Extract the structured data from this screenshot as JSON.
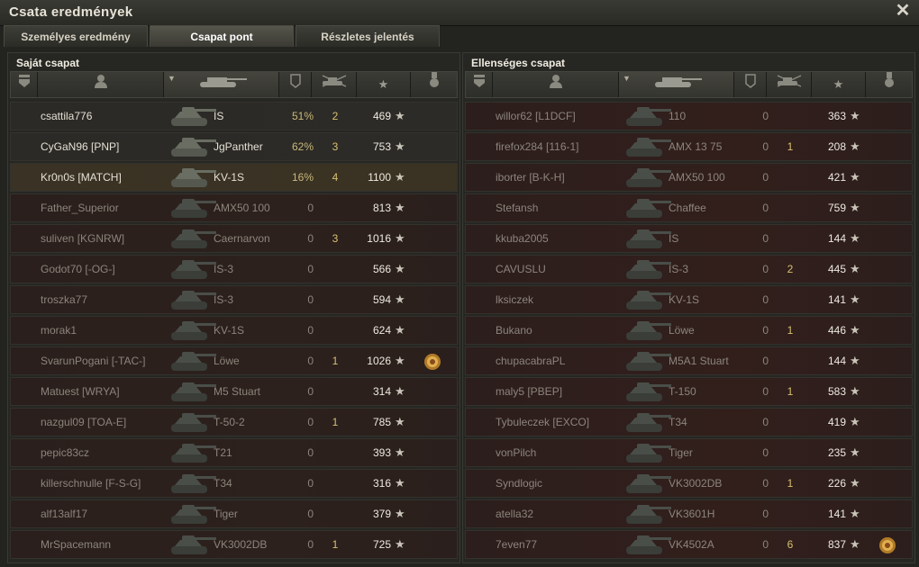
{
  "window": {
    "title": "Csata eredmények",
    "close": "✕"
  },
  "tabs": [
    {
      "label": "Személyes eredmény",
      "active": false
    },
    {
      "label": "Csapat pont",
      "active": true
    },
    {
      "label": "Részletes jelentés",
      "active": false
    }
  ],
  "colors": {
    "accent": "#c8b87a",
    "kills": "#d8c070",
    "dead_row": "#2d211d",
    "player_row": "#3a3322"
  },
  "left_team": {
    "title": "Saját csapat",
    "rows": [
      {
        "name": "csattila776",
        "tank": "IS",
        "pct": "51%",
        "kills": "2",
        "exp": "469",
        "state": "alive",
        "medal": false
      },
      {
        "name": "CyGaN96 [PNP]",
        "tank": "JgPanther",
        "pct": "62%",
        "kills": "3",
        "exp": "753",
        "state": "alive",
        "medal": false
      },
      {
        "name": "Kr0n0s [MATCH]",
        "tank": "KV-1S",
        "pct": "16%",
        "kills": "4",
        "exp": "1100",
        "state": "me",
        "medal": false
      },
      {
        "name": "Father_Superior",
        "tank": "AMX50 100",
        "pct": "0",
        "kills": "",
        "exp": "813",
        "state": "dead",
        "medal": false
      },
      {
        "name": "suliven [KGNRW]",
        "tank": "Caernarvon",
        "pct": "0",
        "kills": "3",
        "exp": "1016",
        "state": "dead",
        "medal": false
      },
      {
        "name": "Godot70 [-OG-]",
        "tank": "IS-3",
        "pct": "0",
        "kills": "",
        "exp": "566",
        "state": "dead",
        "medal": false
      },
      {
        "name": "troszka77",
        "tank": "IS-3",
        "pct": "0",
        "kills": "",
        "exp": "594",
        "state": "dead",
        "medal": false
      },
      {
        "name": "morak1",
        "tank": "KV-1S",
        "pct": "0",
        "kills": "",
        "exp": "624",
        "state": "dead",
        "medal": false
      },
      {
        "name": "SvarunPogani [-TAC-]",
        "tank": "Löwe",
        "pct": "0",
        "kills": "1",
        "exp": "1026",
        "state": "dead",
        "medal": true
      },
      {
        "name": "Matuest [WRYA]",
        "tank": "M5 Stuart",
        "pct": "0",
        "kills": "",
        "exp": "314",
        "state": "dead",
        "medal": false
      },
      {
        "name": "nazgul09 [TOA-E]",
        "tank": "T-50-2",
        "pct": "0",
        "kills": "1",
        "exp": "785",
        "state": "dead",
        "medal": false
      },
      {
        "name": "pepic83cz",
        "tank": "T21",
        "pct": "0",
        "kills": "",
        "exp": "393",
        "state": "dead",
        "medal": false
      },
      {
        "name": "killerschnulle [F-S-G]",
        "tank": "T34",
        "pct": "0",
        "kills": "",
        "exp": "316",
        "state": "dead",
        "medal": false
      },
      {
        "name": "alf13alf17",
        "tank": "Tiger",
        "pct": "0",
        "kills": "",
        "exp": "379",
        "state": "dead",
        "medal": false
      },
      {
        "name": "MrSpacemann",
        "tank": "VK3002DB",
        "pct": "0",
        "kills": "1",
        "exp": "725",
        "state": "dead",
        "medal": false
      }
    ]
  },
  "right_team": {
    "title": "Ellenséges csapat",
    "rows": [
      {
        "name": "willor62 [L1DCF]",
        "tank": "110",
        "pct": "0",
        "kills": "",
        "exp": "363",
        "medal": false
      },
      {
        "name": "firefox284 [116-1]",
        "tank": "AMX 13 75",
        "pct": "0",
        "kills": "1",
        "exp": "208",
        "medal": false
      },
      {
        "name": "iborter [B-K-H]",
        "tank": "AMX50 100",
        "pct": "0",
        "kills": "",
        "exp": "421",
        "medal": false
      },
      {
        "name": "Stefansh",
        "tank": "Chaffee",
        "pct": "0",
        "kills": "",
        "exp": "759",
        "medal": false
      },
      {
        "name": "kkuba2005",
        "tank": "IS",
        "pct": "0",
        "kills": "",
        "exp": "144",
        "medal": false
      },
      {
        "name": "CAVUSLU",
        "tank": "IS-3",
        "pct": "0",
        "kills": "2",
        "exp": "445",
        "medal": false
      },
      {
        "name": "lksiczek",
        "tank": "KV-1S",
        "pct": "0",
        "kills": "",
        "exp": "141",
        "medal": false
      },
      {
        "name": "Bukano",
        "tank": "Löwe",
        "pct": "0",
        "kills": "1",
        "exp": "446",
        "medal": false
      },
      {
        "name": "chupacabraPL",
        "tank": "M5A1 Stuart",
        "pct": "0",
        "kills": "",
        "exp": "144",
        "medal": false
      },
      {
        "name": "maly5 [PBEP]",
        "tank": "T-150",
        "pct": "0",
        "kills": "1",
        "exp": "583",
        "medal": false
      },
      {
        "name": "Tybuleczek [EXCO]",
        "tank": "T34",
        "pct": "0",
        "kills": "",
        "exp": "419",
        "medal": false
      },
      {
        "name": "vonPilch",
        "tank": "Tiger",
        "pct": "0",
        "kills": "",
        "exp": "235",
        "medal": false
      },
      {
        "name": "Syndlogic",
        "tank": "VK3002DB",
        "pct": "0",
        "kills": "1",
        "exp": "226",
        "medal": false
      },
      {
        "name": "atella32",
        "tank": "VK3601H",
        "pct": "0",
        "kills": "",
        "exp": "141",
        "medal": false
      },
      {
        "name": "7even77",
        "tank": "VK4502A",
        "pct": "0",
        "kills": "6",
        "exp": "837",
        "medal": true
      }
    ]
  },
  "columns": [
    {
      "icon": "squad-icon"
    },
    {
      "icon": "player-icon"
    },
    {
      "icon": "tank-icon"
    },
    {
      "icon": "damage-icon"
    },
    {
      "icon": "kills-icon"
    },
    {
      "icon": "experience-star-icon"
    },
    {
      "icon": "medal-icon"
    }
  ]
}
